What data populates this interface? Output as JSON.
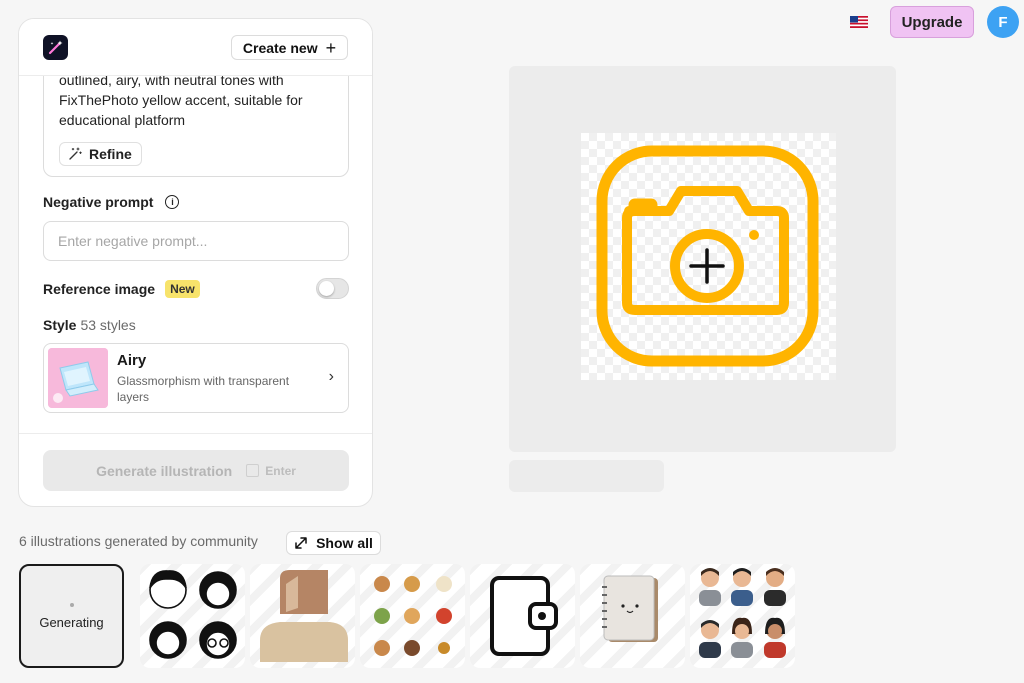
{
  "header": {
    "create_new_label": "Create new",
    "upgrade_label": "Upgrade",
    "avatar_initial": "F"
  },
  "prompt": {
    "text": "outlined, airy, with neutral tones with\nFixThePhoto yellow accent, suitable for\neducational platform",
    "refine_label": "Refine"
  },
  "negative_prompt": {
    "label": "Negative prompt",
    "value": "",
    "placeholder": "Enter negative prompt..."
  },
  "reference_image": {
    "label": "Reference image",
    "badge": "New",
    "enabled": false
  },
  "style": {
    "label": "Style",
    "count": "53 styles",
    "name": "Airy",
    "description": "Glassmorphism with transparent layers"
  },
  "generate": {
    "label": "Generate illustration",
    "shortcut": "Enter"
  },
  "community": {
    "label": "6 illustrations generated by community",
    "show_all_label": "Show all",
    "generating_label": "Generating",
    "thumbnails": [
      "avatars-bw-icon",
      "hair-portrait-icon",
      "food-icons",
      "wallet-icon",
      "notebook-icon",
      "3d-people-avatars"
    ]
  },
  "colors": {
    "accent_yellow": "#ffb400",
    "upgrade_bg": "#f0c3f3",
    "avatar_bg": "#3da2f3"
  }
}
